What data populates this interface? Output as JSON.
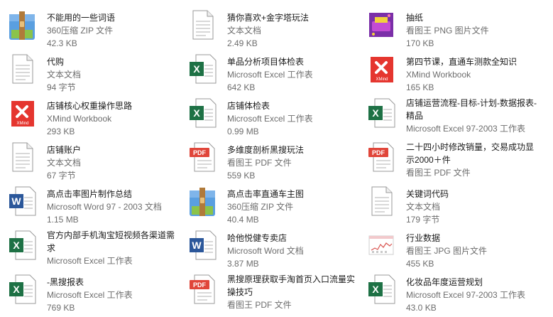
{
  "files": [
    {
      "name": "不能用的一些词语",
      "type": "360压缩 ZIP 文件",
      "size": "42.3 KB",
      "icon": "zip"
    },
    {
      "name": "代购",
      "type": "文本文档",
      "size": "94 字节",
      "icon": "txt"
    },
    {
      "name": "店铺核心权重操作思路",
      "type": "XMind Workbook",
      "size": "293 KB",
      "icon": "xmind"
    },
    {
      "name": "店铺账户",
      "type": "文本文档",
      "size": "67 字节",
      "icon": "txt"
    },
    {
      "name": "高点击率图片制作总结",
      "type": "Microsoft Word 97 - 2003 文档",
      "size": "1.15 MB",
      "icon": "word"
    },
    {
      "name": "官方内部手机淘宝短视频各渠道需求",
      "type": "Microsoft Excel 工作表",
      "size": "",
      "icon": "excel"
    },
    {
      "name": "-黑搜报表",
      "type": "Microsoft Excel 工作表",
      "size": "769 KB",
      "icon": "excel"
    },
    {
      "name": "猜你喜欢+金字塔玩法",
      "type": "文本文档",
      "size": "2.49 KB",
      "icon": "txt"
    },
    {
      "name": "单品分析项目体检表",
      "type": "Microsoft Excel 工作表",
      "size": "642 KB",
      "icon": "excel"
    },
    {
      "name": "店铺体检表",
      "type": "Microsoft Excel 工作表",
      "size": "0.99 MB",
      "icon": "excel"
    },
    {
      "name": "多维度剖析黑搜玩法",
      "type": "看图王 PDF 文件",
      "size": "559 KB",
      "icon": "pdf"
    },
    {
      "name": "高点击率直通车主图",
      "type": "360压缩 ZIP 文件",
      "size": "40.4 MB",
      "icon": "zip"
    },
    {
      "name": "哈他悦健专卖店",
      "type": "Microsoft Word 文档",
      "size": "3.87 MB",
      "icon": "word"
    },
    {
      "name": "黑搜原理获取手淘首页入口流量实操技巧",
      "type": "看图王 PDF 文件",
      "size": "",
      "icon": "pdf"
    },
    {
      "name": "抽纸",
      "type": "看图王 PNG 图片文件",
      "size": "170 KB",
      "icon": "png-thumb"
    },
    {
      "name": "第四节课，直通车测款全知识",
      "type": "XMind Workbook",
      "size": "165 KB",
      "icon": "xmind"
    },
    {
      "name": "店铺运营流程-目标-计划-数据报表-精品",
      "type": "Microsoft Excel 97-2003 工作表",
      "size": "",
      "icon": "excel"
    },
    {
      "name": "二十四小时修改销量，交易成功显示2000＋件",
      "type": "看图王 PDF 文件",
      "size": "",
      "icon": "pdf"
    },
    {
      "name": "关键词代码",
      "type": "文本文档",
      "size": "179 字节",
      "icon": "txt"
    },
    {
      "name": "行业数据",
      "type": "看图王 JPG 图片文件",
      "size": "455 KB",
      "icon": "jpg-thumb"
    },
    {
      "name": "化妆品年度运营规划",
      "type": "Microsoft Excel 97-2003 工作表",
      "size": "43.0 KB",
      "icon": "excel"
    }
  ],
  "colors": {
    "excel": "#1e7145",
    "word": "#2b579a",
    "pdf": "#e0463a",
    "xmind": "#e5362f",
    "zip": "#4a90d9"
  }
}
